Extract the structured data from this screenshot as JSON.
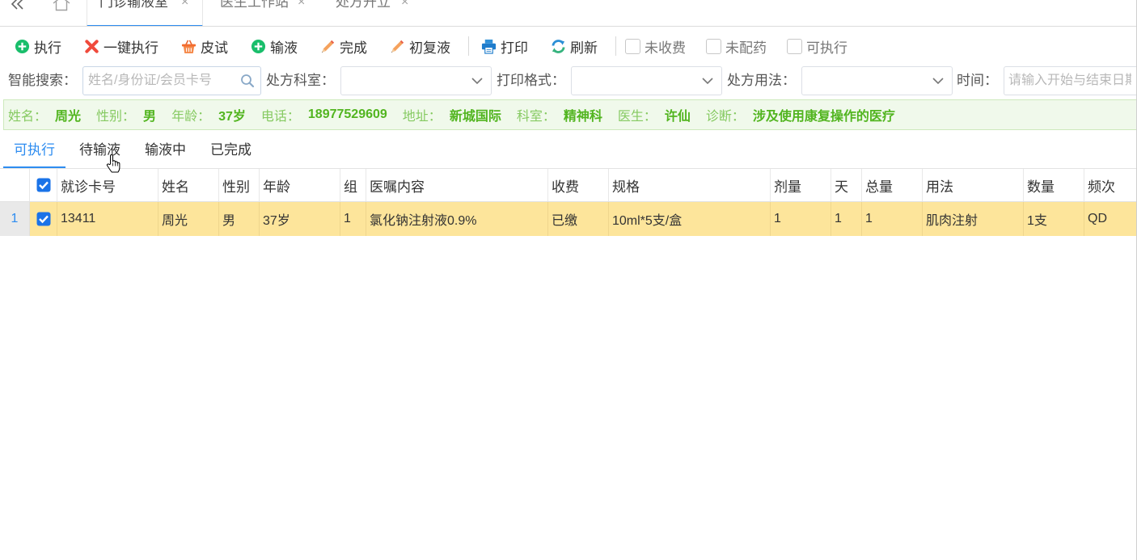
{
  "tabs": {
    "collapse_icon": "double-chevron-left-icon",
    "home_icon": "home-icon",
    "close_glyph": "×",
    "items": [
      {
        "label": "门诊输液室",
        "active": true
      },
      {
        "label": "医生工作站",
        "active": false
      },
      {
        "label": "处方开立",
        "active": false
      }
    ]
  },
  "toolbar": {
    "buttons": [
      {
        "label": "执行",
        "icon": "plus-circle-icon"
      },
      {
        "label": "一键执行",
        "icon": "red-x-icon"
      },
      {
        "label": "皮试",
        "icon": "basket-icon"
      },
      {
        "label": "输液",
        "icon": "plus-circle-icon"
      },
      {
        "label": "完成",
        "icon": "pencil-icon"
      },
      {
        "label": "初复液",
        "icon": "pencil-icon"
      },
      {
        "label": "打印",
        "icon": "printer-icon"
      },
      {
        "label": "刷新",
        "icon": "refresh-icon"
      }
    ],
    "checkboxes": [
      {
        "label": "未收费",
        "checked": false
      },
      {
        "label": "未配药",
        "checked": false
      },
      {
        "label": "可执行",
        "checked": false
      }
    ]
  },
  "search": {
    "smart_search": {
      "label": "智能搜索：",
      "value": "",
      "placeholder": "姓名/身份证/会员卡号",
      "icon": "search-icon"
    },
    "department": {
      "label": "处方科室：",
      "value": ""
    },
    "print_format": {
      "label": "打印格式：",
      "value": ""
    },
    "usage": {
      "label": "处方用法：",
      "value": ""
    },
    "time": {
      "label": "时间：",
      "value": "",
      "placeholder": "请输入开始与结束日期"
    }
  },
  "patient": {
    "fields": [
      {
        "label": "姓名：",
        "value": "周光"
      },
      {
        "label": "性别：",
        "value": "男"
      },
      {
        "label": "年龄：",
        "value": "37岁"
      },
      {
        "label": "电话：",
        "value": "18977529609"
      },
      {
        "label": "地址：",
        "value": "新城国际"
      },
      {
        "label": "科室：",
        "value": "精神科"
      },
      {
        "label": "医生：",
        "value": "许仙"
      },
      {
        "label": "诊断：",
        "value": "涉及使用康复操作的医疗"
      }
    ]
  },
  "status_tabs": {
    "items": [
      {
        "label": "可执行",
        "active": true
      },
      {
        "label": "待输液",
        "active": false
      },
      {
        "label": "输液中",
        "active": false
      },
      {
        "label": "已完成",
        "active": false
      }
    ]
  },
  "table": {
    "header_checked": true,
    "columns": [
      "就诊卡号",
      "姓名",
      "性别",
      "年龄",
      "组",
      "医嘱内容",
      "收费",
      "规格",
      "剂量",
      "天",
      "总量",
      "用法",
      "数量",
      "频次"
    ],
    "rows": [
      {
        "index": "1",
        "checked": true,
        "card_no": "13411",
        "name": "周光",
        "gender": "男",
        "age": "37岁",
        "group": "1",
        "order": "氯化钠注射液0.9%",
        "charge": "已缴",
        "spec": "10ml*5支/盒",
        "dose": "1",
        "days": "1",
        "total": "1",
        "usage": "肌肉注射",
        "quantity": "1支",
        "frequency": "QD"
      }
    ]
  },
  "colors": {
    "accent": "#2d8cf0",
    "selected_row": "#fde59b",
    "patient_bar_bg": "#f0f9eb",
    "patient_label": "#86ca62",
    "patient_value": "#52b520",
    "add_icon": "#19be6b",
    "delete_icon": "#f04a3c"
  }
}
